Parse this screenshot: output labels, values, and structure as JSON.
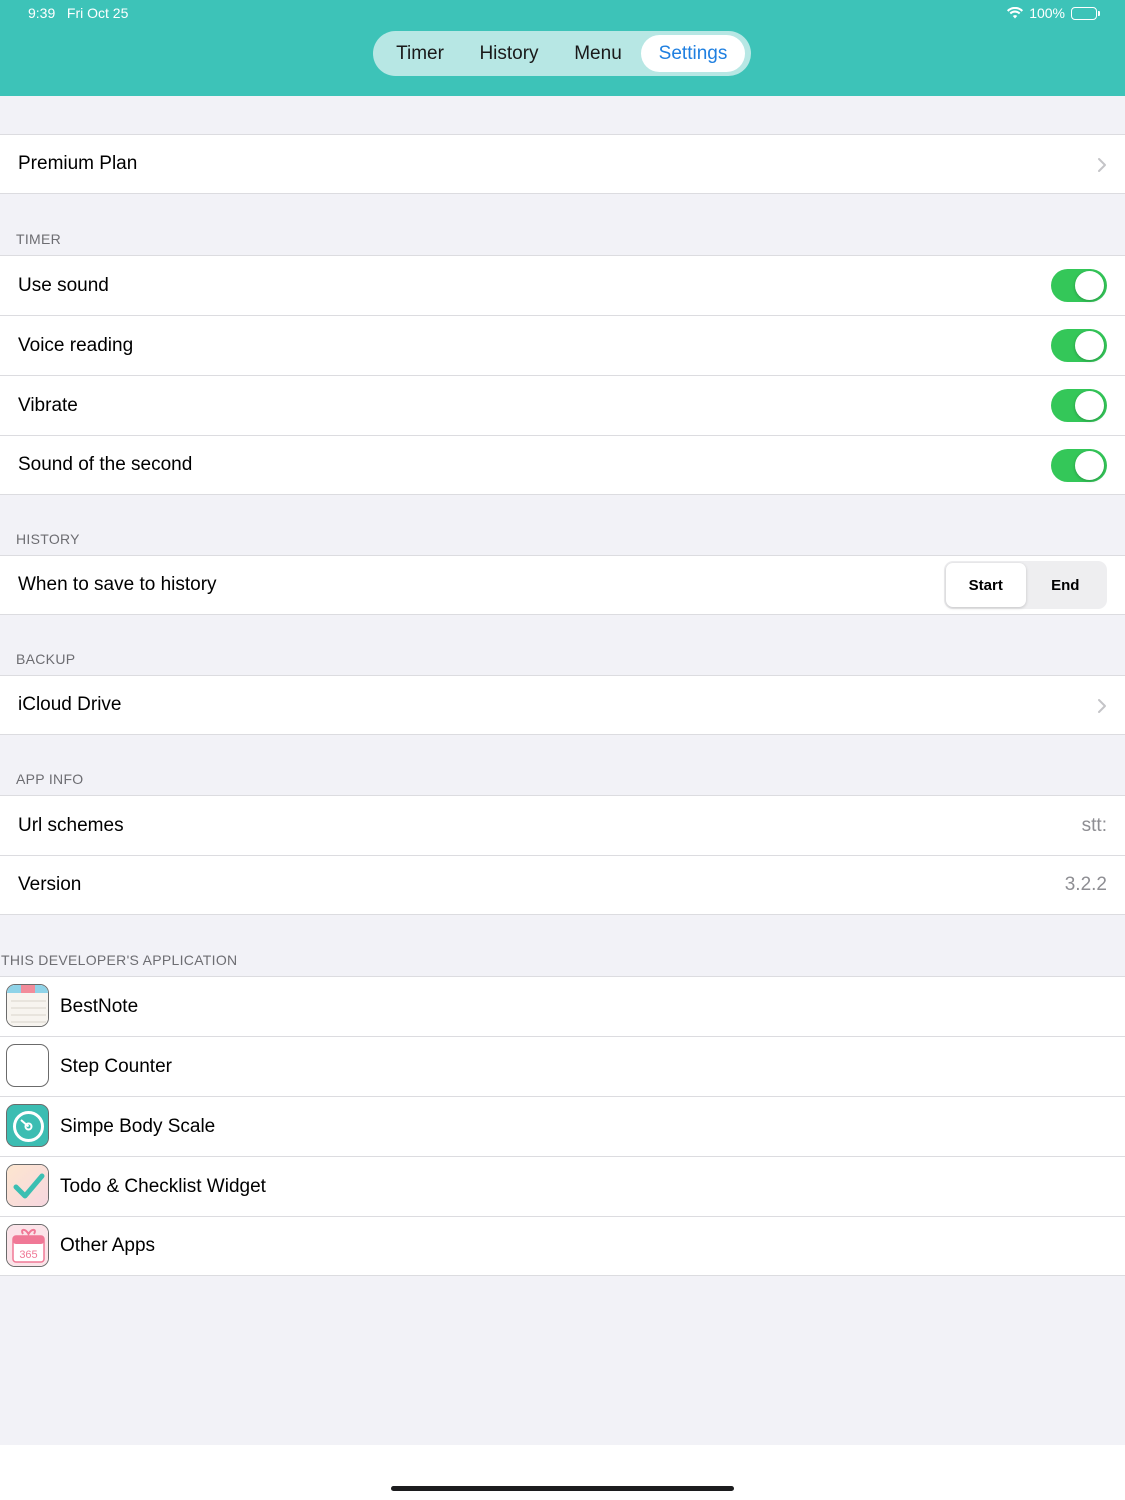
{
  "status_bar": {
    "time": "9:39",
    "date": "Fri Oct 25",
    "battery": "100%",
    "wifi_icon": "wifi-icon",
    "battery_icon": "battery-icon"
  },
  "tabs": [
    {
      "label": "Timer",
      "selected": false
    },
    {
      "label": "History",
      "selected": false
    },
    {
      "label": "Menu",
      "selected": false
    },
    {
      "label": "Settings",
      "selected": true
    }
  ],
  "colors": {
    "header": "#3dc3b8",
    "toggle_on": "#34c759",
    "tab_selected": "#1f7fe0"
  },
  "premium": {
    "label": "Premium Plan"
  },
  "timer": {
    "header": "TIMER",
    "items": [
      {
        "label": "Use sound",
        "on": true
      },
      {
        "label": "Voice reading",
        "on": true
      },
      {
        "label": "Vibrate",
        "on": true
      },
      {
        "label": "Sound of the second",
        "on": true
      }
    ]
  },
  "history": {
    "header": "HISTORY",
    "label": "When to save to history",
    "options": [
      "Start",
      "End"
    ],
    "selected": "Start"
  },
  "backup": {
    "header": "BACKUP",
    "label": "iCloud Drive"
  },
  "app_info": {
    "header": "APP INFO",
    "items": [
      {
        "label": "Url schemes",
        "value": "stt:"
      },
      {
        "label": "Version",
        "value": "3.2.2"
      }
    ]
  },
  "developer": {
    "header": "THIS DEVELOPER'S APPLICATION",
    "apps": [
      {
        "label": "BestNote",
        "icon": "notepad-icon"
      },
      {
        "label": "Step Counter",
        "icon": "blank-app-icon"
      },
      {
        "label": "Simpe Body Scale",
        "icon": "scale-icon"
      },
      {
        "label": "Todo & Checklist Widget",
        "icon": "checkmark-icon"
      },
      {
        "label": "Other Apps",
        "icon": "calendar-365-icon",
        "icon_text": "365"
      }
    ]
  }
}
